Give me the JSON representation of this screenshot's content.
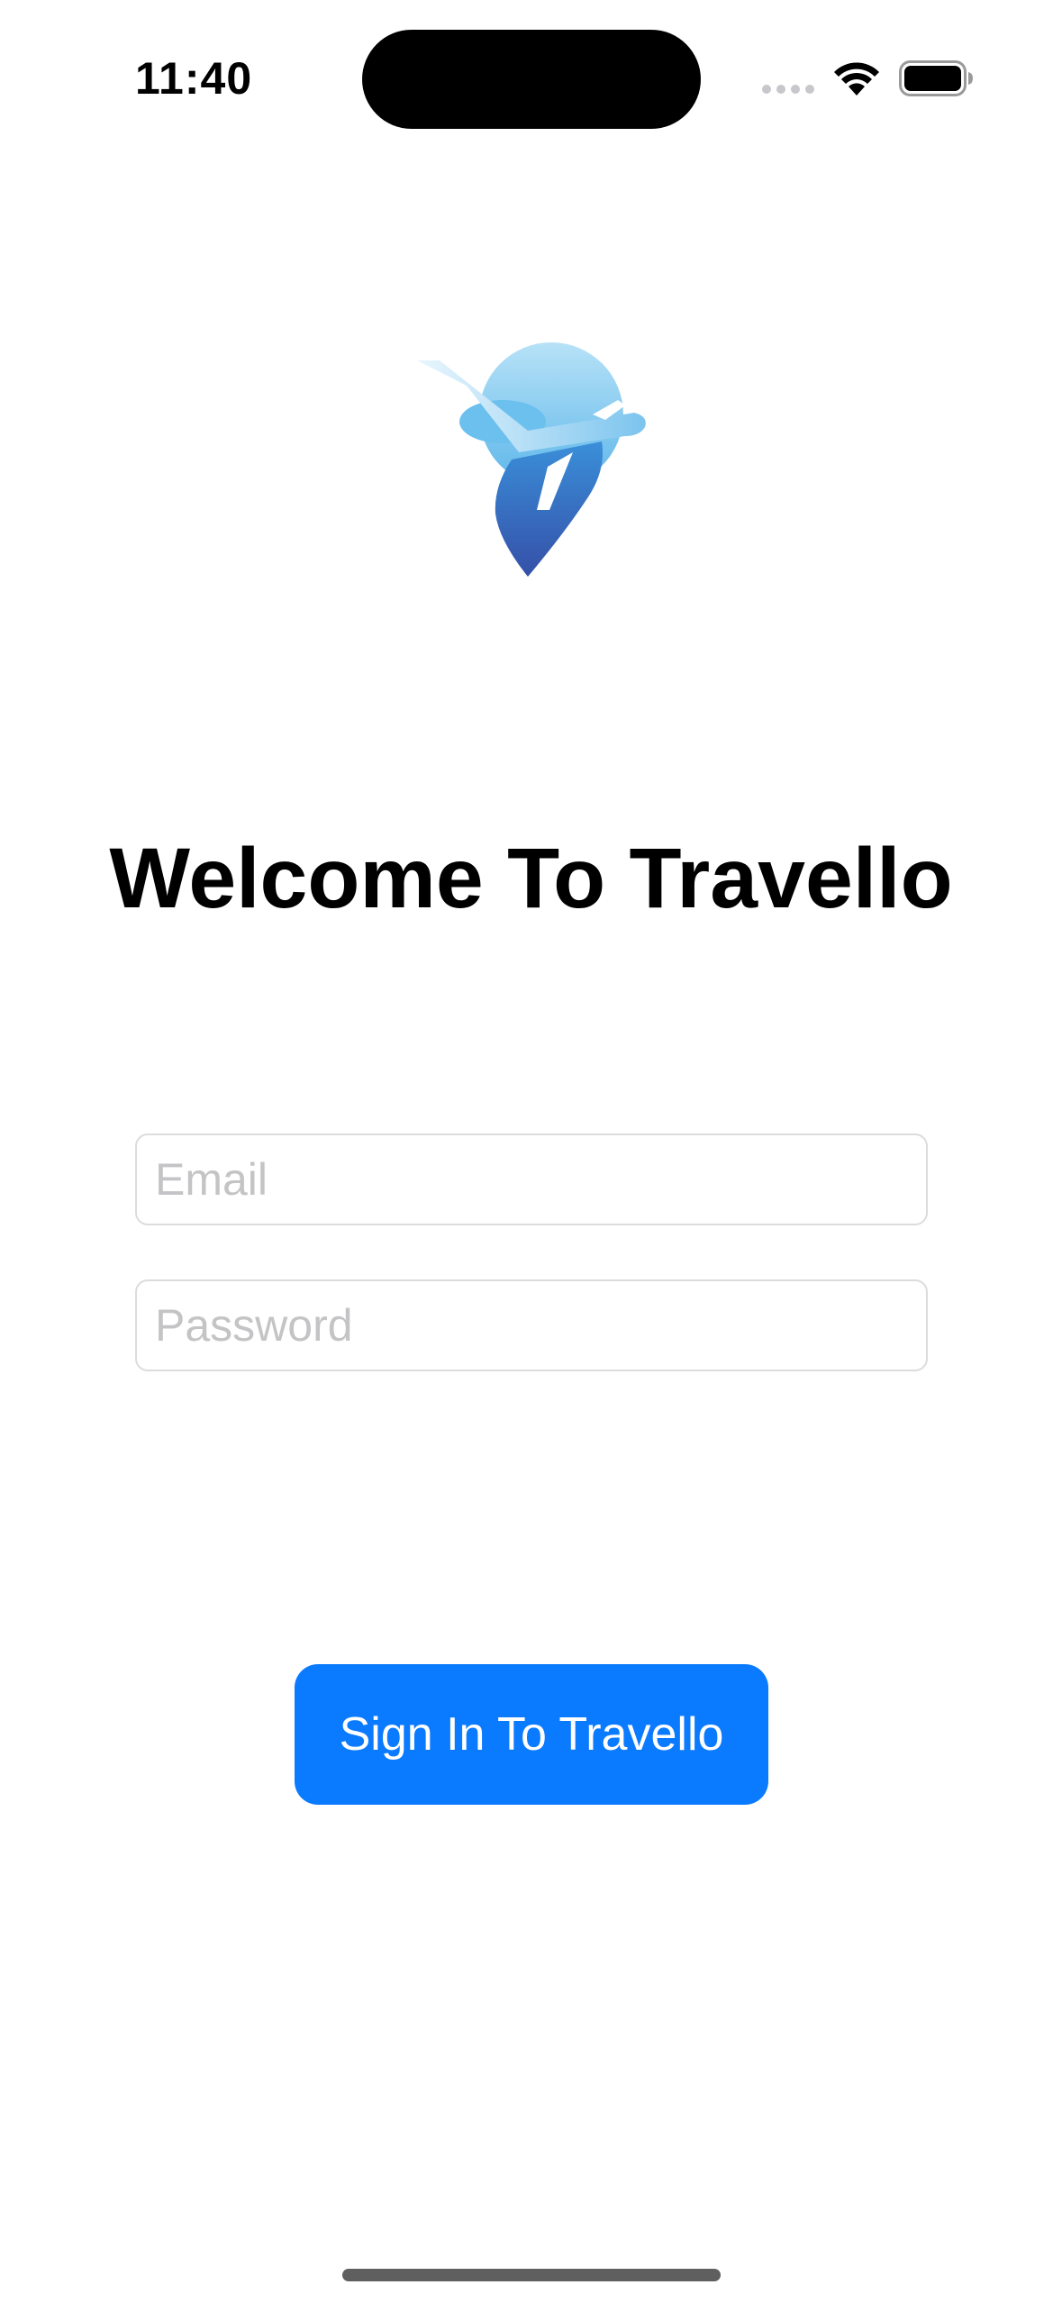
{
  "status_bar": {
    "time": "11:40",
    "icons": [
      "cellular-signal-icon",
      "wifi-icon",
      "battery-icon"
    ]
  },
  "logo": {
    "icon": "travel-plane-location-pin-logo",
    "colors": {
      "light_blue": "#8fd0f2",
      "mid_blue": "#3a8fd9",
      "deep_blue": "#3550a8"
    }
  },
  "welcome": {
    "title": "Welcome To Travello"
  },
  "form": {
    "email": {
      "value": "",
      "placeholder": "Email"
    },
    "password": {
      "value": "",
      "placeholder": "Password"
    },
    "submit_label": "Sign In To Travello"
  },
  "colors": {
    "accent": "#0a7aff",
    "placeholder": "#c4c4c6",
    "field_border": "#dcdcdc"
  }
}
